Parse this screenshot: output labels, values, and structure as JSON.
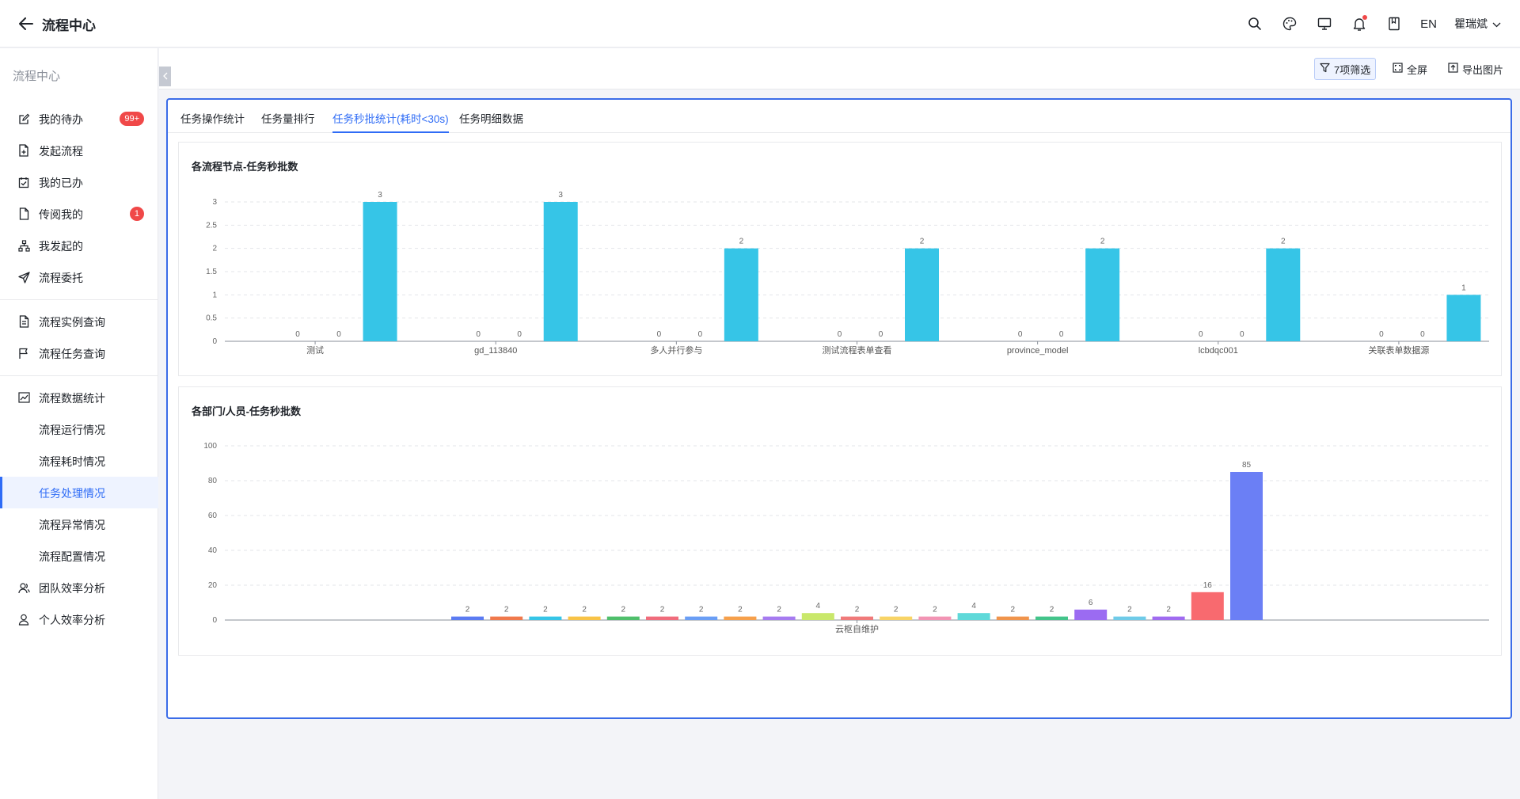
{
  "header": {
    "title": "流程中心",
    "lang": "EN",
    "user": "瞿瑞斌"
  },
  "sidebar": {
    "title": "流程中心",
    "items": [
      {
        "label": "我的待办",
        "icon": "edit-icon",
        "badge": "99+"
      },
      {
        "label": "发起流程",
        "icon": "file-add-icon",
        "badge": ""
      },
      {
        "label": "我的已办",
        "icon": "calendar-check-icon",
        "badge": ""
      },
      {
        "label": "传阅我的",
        "icon": "document-icon",
        "badge": "1"
      },
      {
        "label": "我发起的",
        "icon": "org-tree-icon",
        "badge": ""
      },
      {
        "label": "流程委托",
        "icon": "send-icon",
        "badge": ""
      },
      {
        "label": "流程实例查询",
        "icon": "file-search-icon",
        "badge": ""
      },
      {
        "label": "流程任务查询",
        "icon": "flag-icon",
        "badge": ""
      },
      {
        "label": "流程数据统计",
        "icon": "line-chart-icon",
        "badge": ""
      },
      {
        "label": "流程运行情况",
        "icon": "",
        "badge": ""
      },
      {
        "label": "流程耗时情况",
        "icon": "",
        "badge": ""
      },
      {
        "label": "任务处理情况",
        "icon": "",
        "badge": ""
      },
      {
        "label": "流程异常情况",
        "icon": "",
        "badge": ""
      },
      {
        "label": "流程配置情况",
        "icon": "",
        "badge": ""
      },
      {
        "label": "团队效率分析",
        "icon": "team-icon",
        "badge": ""
      },
      {
        "label": "个人效率分析",
        "icon": "user-icon",
        "badge": ""
      }
    ]
  },
  "toolbar": {
    "filter_label": "7项筛选",
    "fullscreen_label": "全屏",
    "export_label": "导出图片"
  },
  "tabs": [
    {
      "label": "任务操作统计"
    },
    {
      "label": "任务量排行"
    },
    {
      "label": "任务秒批统计(耗时<30s)"
    },
    {
      "label": "任务明细数据"
    }
  ],
  "colors": {
    "accent": "#2f6cf6",
    "chart1_bar": "#36c5e7"
  },
  "chart_data": [
    {
      "type": "bar",
      "title": "各流程节点-任务秒批数",
      "categories": [
        "测试",
        "gd_113840",
        "多人并行参与",
        "测试流程表单查看",
        "province_model",
        "lcbdqc001",
        "关联表单数据源"
      ],
      "series": [
        {
          "values": [
            0,
            0,
            0,
            0,
            0,
            0,
            0
          ]
        },
        {
          "values": [
            0,
            0,
            0,
            0,
            0,
            0,
            0
          ]
        },
        {
          "values": [
            3,
            3,
            2,
            2,
            2,
            2,
            1
          ]
        }
      ],
      "ylim": [
        0,
        3
      ],
      "yticks": [
        "0",
        "0.5",
        "1",
        "1.5",
        "2",
        "2.5",
        "3"
      ],
      "grid": true
    },
    {
      "type": "bar",
      "title": "各部门/人员-任务秒批数",
      "categories": [
        "云枢自维护"
      ],
      "series": [
        {
          "values": [
            2
          ],
          "color": "#5b7bf2"
        },
        {
          "values": [
            2
          ],
          "color": "#f0794c"
        },
        {
          "values": [
            2
          ],
          "color": "#36c5e7"
        },
        {
          "values": [
            2
          ],
          "color": "#f8c346"
        },
        {
          "values": [
            2
          ],
          "color": "#4fbf6b"
        },
        {
          "values": [
            2
          ],
          "color": "#f06c7c"
        },
        {
          "values": [
            2
          ],
          "color": "#6a9ef5"
        },
        {
          "values": [
            2
          ],
          "color": "#f6a04b"
        },
        {
          "values": [
            2
          ],
          "color": "#a67bf0"
        },
        {
          "values": [
            4
          ],
          "color": "#c9e86b"
        },
        {
          "values": [
            2
          ],
          "color": "#f07a7a"
        },
        {
          "values": [
            2
          ],
          "color": "#f8d466"
        },
        {
          "values": [
            2
          ],
          "color": "#f294b4"
        },
        {
          "values": [
            4
          ],
          "color": "#5fd9d9"
        },
        {
          "values": [
            2
          ],
          "color": "#f0944c"
        },
        {
          "values": [
            2
          ],
          "color": "#43c48a"
        },
        {
          "values": [
            6
          ],
          "color": "#9b6bf2"
        },
        {
          "values": [
            2
          ],
          "color": "#6fcbe8"
        },
        {
          "values": [
            2
          ],
          "color": "#a06bf0"
        },
        {
          "values": [
            16
          ],
          "color": "#f86a6f"
        },
        {
          "values": [
            85
          ],
          "color": "#6b7ff5"
        }
      ],
      "ylim": [
        0,
        100
      ],
      "yticks": [
        "0",
        "20",
        "40",
        "60",
        "80",
        "100"
      ],
      "grid": true
    }
  ]
}
